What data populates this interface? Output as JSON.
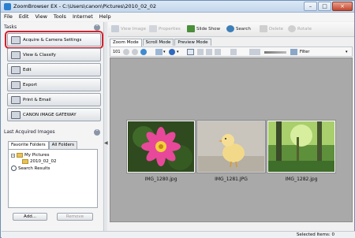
{
  "window": {
    "title": "ZoomBrowser EX  -  C:\\Users\\canon\\Pictures\\2010_02_02",
    "controls": [
      "–",
      "□",
      "×"
    ]
  },
  "menu": [
    "File",
    "Edit",
    "View",
    "Tools",
    "Internet",
    "Help"
  ],
  "tasks": {
    "header": "Tasks",
    "items": [
      {
        "label": "Acquire & Camera Settings",
        "selected": true
      },
      {
        "label": "View & Classify",
        "selected": false
      },
      {
        "label": "Edit",
        "selected": false
      },
      {
        "label": "Export",
        "selected": false
      },
      {
        "label": "Print & Email",
        "selected": false
      },
      {
        "label": "CANON iMAGE GATEWAY",
        "selected": false
      }
    ]
  },
  "last_acquired": {
    "header": "Last Acquired Images"
  },
  "favorites": {
    "tabs": [
      "Favorite Folders",
      "All Folders"
    ],
    "tree": [
      "My Pictures",
      "2010_02_02",
      "Search Results"
    ],
    "add_label": "Add...",
    "remove_label": "Remove"
  },
  "toolbar": {
    "view_image": "View Image",
    "properties": "Properties",
    "slide_show": "Slide Show",
    "search": "Search",
    "delete": "Delete",
    "rotate": "Rotate"
  },
  "view_tabs": [
    "Zoom Mode",
    "Scroll Mode",
    "Preview Mode"
  ],
  "viewbar": {
    "count_label": "101",
    "filter_label": "Filter"
  },
  "thumbnails": [
    {
      "filename": "IMG_1280.jpg",
      "subject": "pink flower"
    },
    {
      "filename": "IMG_1281.JPG",
      "subject": "chick"
    },
    {
      "filename": "IMG_1282.jpg",
      "subject": "forest"
    }
  ],
  "status": {
    "selected_items": "Selected Items: 0"
  },
  "colors": {
    "selection_outline": "#d91e2a",
    "content_bg": "#a9a9a9"
  }
}
